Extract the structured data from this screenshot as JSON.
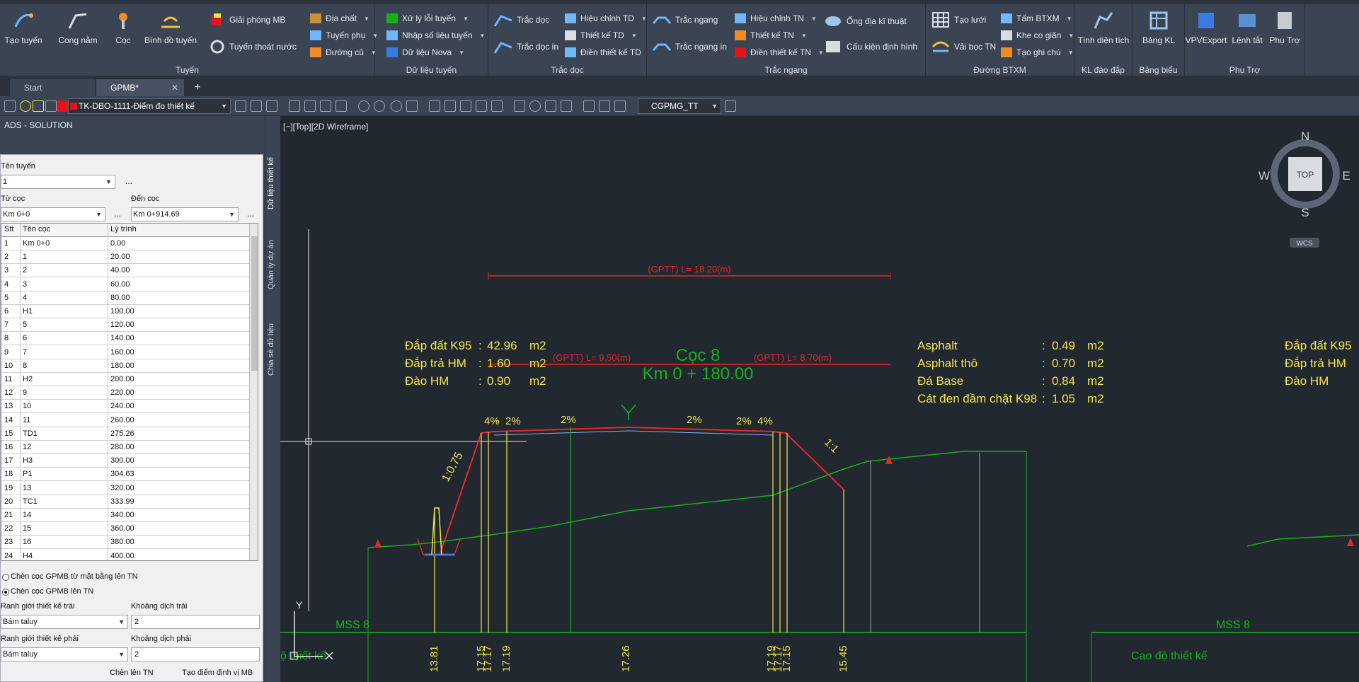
{
  "ribbon": {
    "buttons": {
      "tao_tuyen": "Tạo tuyến",
      "cong_nam": "Cong nằm",
      "coc": "Cọc",
      "binh_do_tuyen": "Bình đồ tuyến",
      "giai_phong_mb": "Giải phóng MB",
      "tuyen_thoat_nuoc": "Tuyến thoát nước",
      "dia_chat": "Địa chất",
      "tuyen_phu": "Tuyến phụ",
      "duong_cu": "Đường cũ",
      "xu_ly_loi_tuyen": "Xử lý lỗi tuyến",
      "nhap_so_lieu_tuyen": "Nhập số liệu tuyến",
      "du_lieu_nova": "Dữ liệu Nova",
      "trac_doc": "Trắc dọc",
      "trac_doc_in": "Trắc dọc in",
      "hieu_chinh_td": "Hiệu chỉnh TD",
      "thiet_ke_td": "Thiết kế TD",
      "dien_thiet_ke_td": "Điền thiết kế TD",
      "trac_ngang": "Trắc ngang",
      "trac_ngang_in": "Trắc ngang in",
      "hieu_chinh_tn": "Hiệu chỉnh TN",
      "thiet_ke_tn": "Thiết kế TN",
      "dien_thiet_ke_tn": "Điền thiết kế TN",
      "ong_dia_ki_thuat": "Ống địa kĩ thuật",
      "cau_kien_dinh_hinh": "Cấu kiện định hình",
      "tao_luoi": "Tạo lưới",
      "vai_boc_tn": "Vải bọc TN",
      "tam_btxm": "Tấm BTXM",
      "khe_co_gian": "Khe co giãn",
      "tao_ghi_chu": "Tạo ghi chú",
      "tinh_dien_tich": "Tính diện tích",
      "bang_kl": "Bảng KL",
      "vpvexport": "VPVExport",
      "lenh_tat": "Lệnh tắt",
      "phu_tro": "Phụ Trợ"
    },
    "panels": {
      "tuyen": "Tuyến",
      "du_lieu_tuyen": "Dữ liệu tuyến",
      "trac_doc": "Trắc dọc",
      "trac_ngang": "Trắc ngang",
      "duong_btxm": "Đường BTXM",
      "kl_dao_dap": "KL đào đắp",
      "bang_bieu": "Bảng biểu",
      "phu_tro": "Phụ Trợ"
    }
  },
  "tabs": {
    "start": "Start",
    "doc": "GPMB*",
    "close": "✕",
    "add": "+"
  },
  "toolbar": {
    "layer": "TK-DBO-1111-Điểm đo thiết kế",
    "text_style": "CGPMG_TT"
  },
  "palette": {
    "title": "ADS - SOLUTION",
    "ten_tuyen_label": "Tên tuyến",
    "ten_tuyen_value": "1",
    "tu_coc_label": "Từ cọc",
    "tu_coc_value": "Km 0+0",
    "den_coc_label": "Đến cọc",
    "den_coc_value": "Km 0+914.69",
    "dots": "...",
    "columns": [
      "Stt",
      "Tên cọc",
      "Lý trình"
    ],
    "rows": [
      [
        "1",
        "Km 0+0",
        "0.00"
      ],
      [
        "2",
        "1",
        "20.00"
      ],
      [
        "3",
        "2",
        "40.00"
      ],
      [
        "4",
        "3",
        "60.00"
      ],
      [
        "5",
        "4",
        "80.00"
      ],
      [
        "6",
        "H1",
        "100.00"
      ],
      [
        "7",
        "5",
        "120.00"
      ],
      [
        "8",
        "6",
        "140.00"
      ],
      [
        "9",
        "7",
        "160.00"
      ],
      [
        "10",
        "8",
        "180.00"
      ],
      [
        "11",
        "H2",
        "200.00"
      ],
      [
        "12",
        "9",
        "220.00"
      ],
      [
        "13",
        "10",
        "240.00"
      ],
      [
        "14",
        "11",
        "260.00"
      ],
      [
        "15",
        "TD1",
        "275.26"
      ],
      [
        "16",
        "12",
        "280.00"
      ],
      [
        "17",
        "H3",
        "300.00"
      ],
      [
        "18",
        "P1",
        "304.63"
      ],
      [
        "19",
        "13",
        "320.00"
      ],
      [
        "20",
        "TC1",
        "333.99"
      ],
      [
        "21",
        "14",
        "340.00"
      ],
      [
        "22",
        "15",
        "360.00"
      ],
      [
        "23",
        "16",
        "380.00"
      ],
      [
        "24",
        "H4",
        "400.00"
      ]
    ],
    "radio1": "Chèn cọc GPMB từ mặt bằng lên TN",
    "radio2": "Chèn cọc GPMB lên TN",
    "ranh_gioi_trai_label": "Ranh giới thiết kế trái",
    "ranh_gioi_trai_value": "Bám taluy",
    "khoang_dich_trai_label": "Khoảng dịch trái",
    "khoang_dich_trai_value": "2",
    "ranh_gioi_phai_label": "Ranh giới thiết kế phải",
    "ranh_gioi_phai_value": "Bám taluy",
    "khoang_dich_phai_label": "Khoảng dịch phải",
    "khoang_dich_phai_value": "2",
    "btn_chen": "Chèn lên TN",
    "btn_tao": "Tạo điểm định vị MB"
  },
  "side_tabs": [
    "Dữ liệu thiết kế",
    "Quản lý dự án",
    "Chia sẻ dữ liệu"
  ],
  "canvas": {
    "viewport_label": "[−][Top][2D Wireframe]",
    "viewcube": {
      "n": "N",
      "s": "S",
      "e": "E",
      "w": "W",
      "top": "TOP",
      "wcs": "WCS"
    },
    "gptt_total": "(GPTT) L= 18.20(m)",
    "gptt_left": "(GPTT) L= 9.50(m)",
    "gptt_right": "(GPTT) L= 8.70(m)",
    "coc_name": "Cọc 8",
    "coc_km": "Km 0 + 180.00",
    "left_vol": [
      {
        "label": "Đắp đất K95",
        "value": "42.96",
        "unit": "m2"
      },
      {
        "label": "Đắp trả HM",
        "value": "1.60",
        "unit": "m2"
      },
      {
        "label": "Đào HM",
        "value": "0.90",
        "unit": "m2"
      }
    ],
    "right_vol": [
      {
        "label": "Asphalt",
        "value": "0.49",
        "unit": "m2"
      },
      {
        "label": "Asphalt thô",
        "value": "0.70",
        "unit": "m2"
      },
      {
        "label": "Đá Base",
        "value": "0.84",
        "unit": "m2"
      },
      {
        "label": "Cát đen đầm chặt K98",
        "value": "1.05",
        "unit": "m2"
      }
    ],
    "far_right_vol": [
      "Đắp đất K95",
      "Đắp trả HM",
      "Đào HM"
    ],
    "colon": ":",
    "slopes": [
      "4%",
      "2%",
      "2%",
      "2%",
      "2%",
      "4%"
    ],
    "slope_left": "1:0.75",
    "slope_right": "1:1",
    "elevations": [
      "13.81",
      "17.15",
      "17.17",
      "17.19",
      "17.26",
      "17.19",
      "17.17",
      "17.15",
      "15.45"
    ],
    "mss_left": "MSS 8",
    "mss_right": "MSS 8",
    "cao_do_left": "ộ thiết kế",
    "cao_do_right": "Cao độ thiết kế",
    "ucs_y": "Y"
  },
  "colors": {
    "yellow": "#f4e64a",
    "red": "#e8262b",
    "green": "#17b21a",
    "white": "#ffffff",
    "bg": "#212830"
  }
}
